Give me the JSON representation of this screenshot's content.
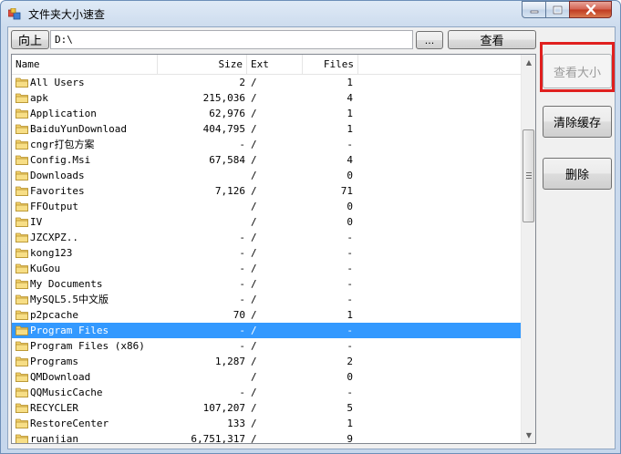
{
  "window": {
    "title": "文件夹大小速查"
  },
  "toolbar": {
    "up_label": "向上",
    "path_value": "D:\\",
    "browse_label": "...",
    "view_label": "查看"
  },
  "columns": {
    "name": "Name",
    "size": "Size",
    "ext": "Ext",
    "files": "Files"
  },
  "actions": {
    "view_size_label": "查看大小",
    "clear_cache_label": "清除缓存",
    "delete_label": "删除"
  },
  "colors": {
    "selection": "#3399ff",
    "highlight_border": "#e0201f",
    "folder": "#f2d16b"
  },
  "rows": [
    {
      "name": "All Users",
      "size": "2",
      "ext": "/",
      "files": "1"
    },
    {
      "name": "apk",
      "size": "215,036",
      "ext": "/",
      "files": "4"
    },
    {
      "name": "Application",
      "size": "62,976",
      "ext": "/",
      "files": "1"
    },
    {
      "name": "BaiduYunDownload",
      "size": "404,795",
      "ext": "/",
      "files": "1"
    },
    {
      "name": "cngr打包方案",
      "size": "-",
      "ext": "/",
      "files": "-"
    },
    {
      "name": "Config.Msi",
      "size": "67,584",
      "ext": "/",
      "files": "4"
    },
    {
      "name": "Downloads",
      "size": "",
      "ext": "/",
      "files": "0"
    },
    {
      "name": "Favorites",
      "size": "7,126",
      "ext": "/",
      "files": "71"
    },
    {
      "name": "FFOutput",
      "size": "",
      "ext": "/",
      "files": "0"
    },
    {
      "name": "IV",
      "size": "",
      "ext": "/",
      "files": "0"
    },
    {
      "name": "JZCXPZ..",
      "size": "-",
      "ext": "/",
      "files": "-"
    },
    {
      "name": "kong123",
      "size": "-",
      "ext": "/",
      "files": "-"
    },
    {
      "name": "KuGou",
      "size": "-",
      "ext": "/",
      "files": "-"
    },
    {
      "name": "My Documents",
      "size": "-",
      "ext": "/",
      "files": "-"
    },
    {
      "name": "MySQL5.5中文版",
      "size": "-",
      "ext": "/",
      "files": "-"
    },
    {
      "name": "p2pcache",
      "size": "70",
      "ext": "/",
      "files": "1"
    },
    {
      "name": "Program Files",
      "size": "-",
      "ext": "/",
      "files": "-",
      "selected": true
    },
    {
      "name": "Program Files (x86)",
      "size": "-",
      "ext": "/",
      "files": "-"
    },
    {
      "name": "Programs",
      "size": "1,287",
      "ext": "/",
      "files": "2"
    },
    {
      "name": "QMDownload",
      "size": "",
      "ext": "/",
      "files": "0"
    },
    {
      "name": "QQMusicCache",
      "size": "-",
      "ext": "/",
      "files": "-"
    },
    {
      "name": "RECYCLER",
      "size": "107,207",
      "ext": "/",
      "files": "5"
    },
    {
      "name": "RestoreCenter",
      "size": "133",
      "ext": "/",
      "files": "1"
    },
    {
      "name": "ruanjian",
      "size": "6,751,317",
      "ext": "/",
      "files": "9"
    }
  ]
}
